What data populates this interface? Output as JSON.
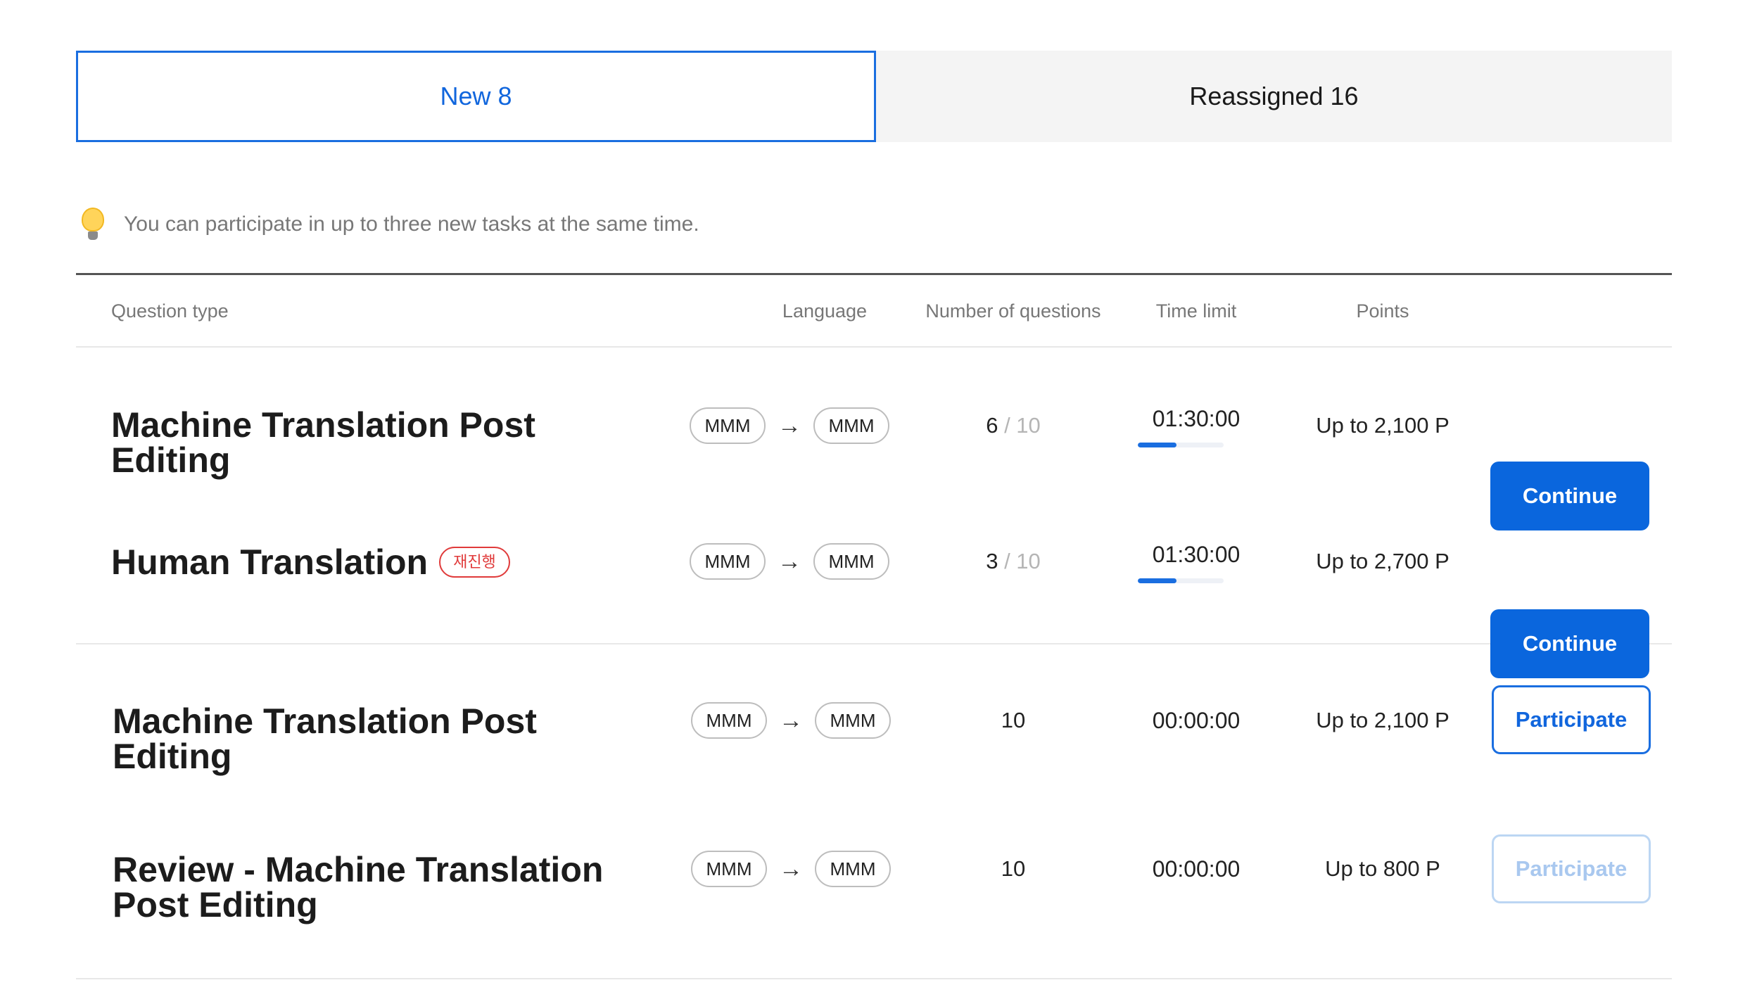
{
  "tabs": [
    {
      "label": "New 8",
      "active": true
    },
    {
      "label": "Reassigned 16",
      "active": false
    }
  ],
  "notice": {
    "icon": "lightbulb-icon",
    "text": "You can participate in up to three new tasks at the same time."
  },
  "table": {
    "headers": {
      "type": "Question type",
      "language": "Language",
      "num": "Number of questions",
      "time": "Time limit",
      "points": "Points"
    },
    "rows": [
      {
        "type_line1": "Machine Translation Post",
        "type_line2": "Editing",
        "badge": "",
        "lang_from": "MMM",
        "arrow": "→",
        "lang_to": "MMM",
        "num_done": "6",
        "num_sep": " / ",
        "num_total": "10",
        "time": "01:30:00",
        "time_progress": 0.45,
        "points": "Up to 2,100 P",
        "button": "Continue"
      },
      {
        "type_line1": "Human Translation",
        "badge": "재진행",
        "lang_from": "MMM",
        "arrow": "→",
        "lang_to": "MMM",
        "num_done": "3",
        "num_sep": " / ",
        "num_total": "10",
        "time": "01:30:00",
        "time_progress": 0.45,
        "points": "Up to 2,700 P",
        "button": "Continue"
      },
      {
        "type_line1": "Machine Translation Post",
        "type_line2": "Editing",
        "lang_from": "MMM",
        "arrow": "→",
        "lang_to": "MMM",
        "num": "10",
        "time": "00:00:00",
        "points": "Up to 2,100 P",
        "button": "Participate"
      },
      {
        "type_line1": "Review - Machine Translation",
        "type_line2": "Post Editing",
        "lang_from": "MMM",
        "arrow": "→",
        "lang_to": "MMM",
        "num": "10",
        "time": "00:00:00",
        "points": "Up to 800 P",
        "button": "Participate",
        "button_disabled": true
      }
    ]
  },
  "colors": {
    "accent": "#0a66dd",
    "badge": "#e03a3a",
    "disabled": "#bcd6f3"
  }
}
